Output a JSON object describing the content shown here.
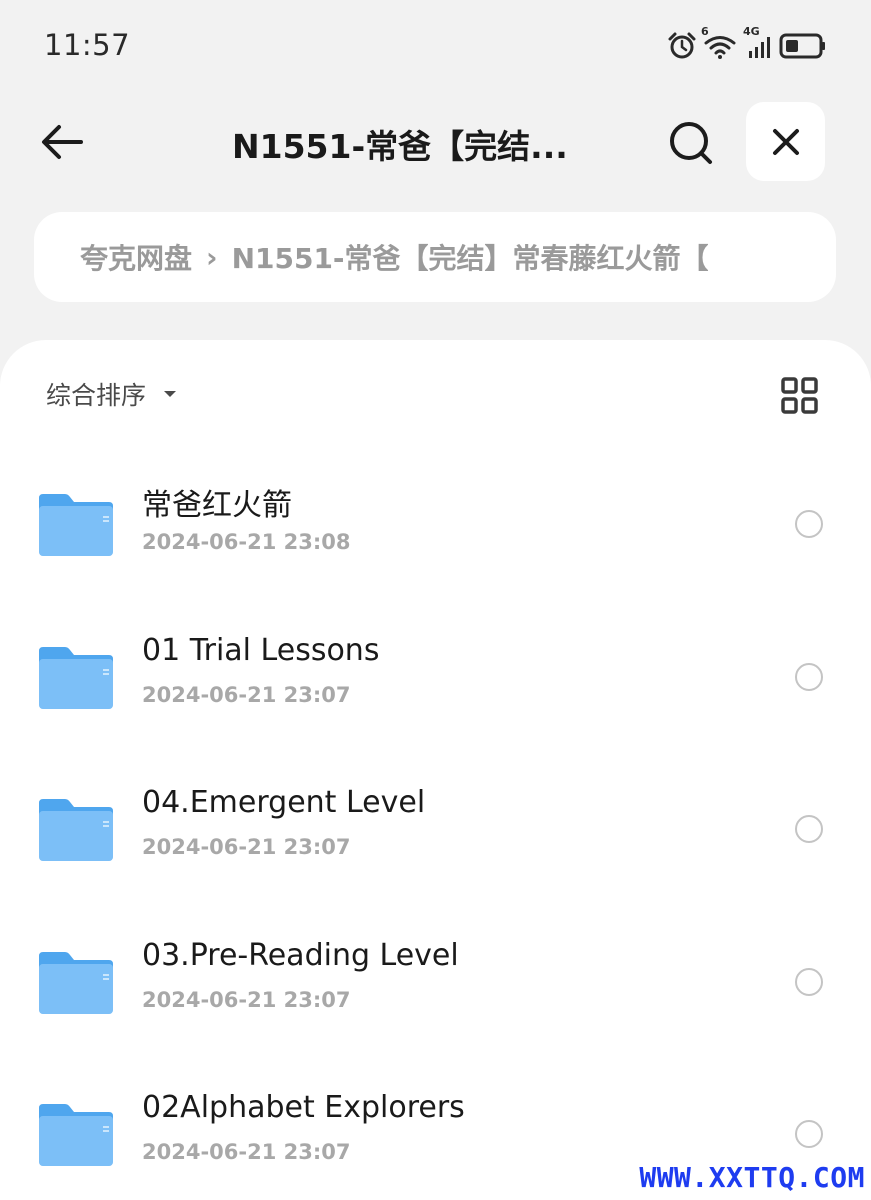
{
  "status_bar": {
    "time": "11:57",
    "icons": [
      "alarm-icon",
      "wifi-icon",
      "cellular-4g-icon",
      "battery-icon"
    ],
    "wifi_badge": "6",
    "network_type": "4G"
  },
  "header": {
    "title": "N1551-常爸【完结...",
    "icons": [
      "back-arrow-icon",
      "search-icon",
      "close-icon"
    ]
  },
  "breadcrumb": {
    "items": [
      "夸克网盘",
      "N1551-常爸【完结】常春藤红火箭【"
    ],
    "separator": "›"
  },
  "toolbar": {
    "sort_label": "综合排序",
    "sort_icon": "caret-down-icon",
    "view_icon": "grid-view-icon"
  },
  "files": [
    {
      "name": "常爸红火箭",
      "date": "2024-06-21 23:08",
      "type": "folder"
    },
    {
      "name": "01 Trial Lessons",
      "date": "2024-06-21 23:07",
      "type": "folder"
    },
    {
      "name": "04.Emergent Level",
      "date": "2024-06-21 23:07",
      "type": "folder"
    },
    {
      "name": "03.Pre-Reading Level",
      "date": "2024-06-21 23:07",
      "type": "folder"
    },
    {
      "name": "02Alphabet Explorers",
      "date": "2024-06-21 23:07",
      "type": "folder"
    }
  ],
  "watermark": "WWW.XXTTQ.COM",
  "colors": {
    "background": "#f2f2f2",
    "card": "#ffffff",
    "folder_blue": "#6fb8f5",
    "secondary_text": "#a8a8a8",
    "watermark": "#1e3cf0"
  }
}
